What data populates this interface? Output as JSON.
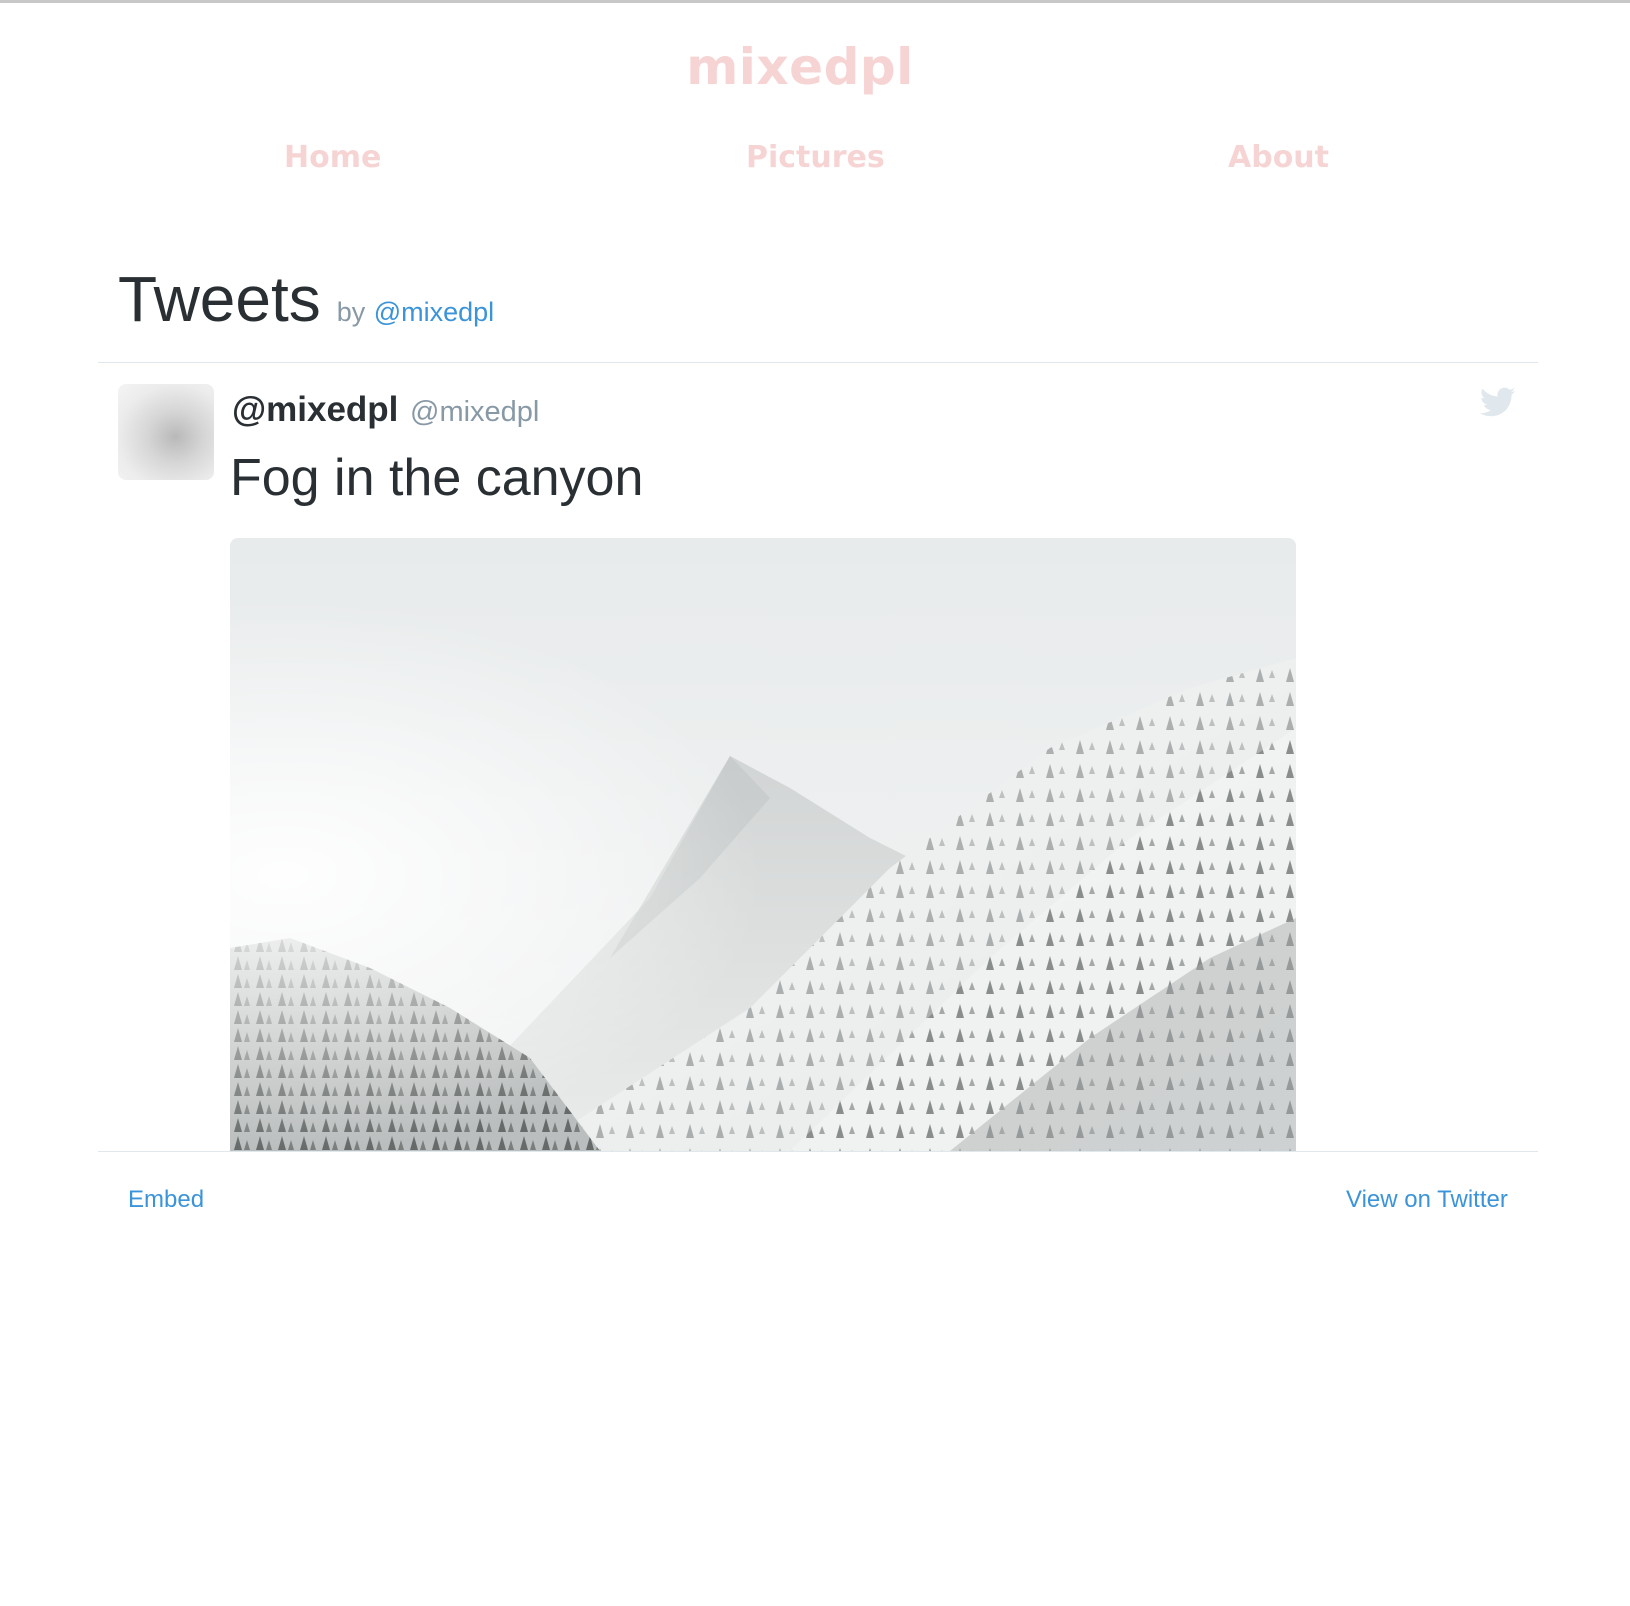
{
  "site": {
    "title": "mixedpl",
    "nav": [
      {
        "label": "Home"
      },
      {
        "label": "Pictures"
      },
      {
        "label": "About"
      }
    ]
  },
  "widget": {
    "title": "Tweets",
    "by_label": "by",
    "handle": "@mixedpl"
  },
  "tweet": {
    "display_name": "@mixedpl",
    "screen_name": "@mixedpl",
    "text": "Fog in the canyon",
    "media_icon": "bird-icon"
  },
  "footer": {
    "embed_label": "Embed",
    "view_label": "View on Twitter"
  },
  "colors": {
    "site_pink": "#f7d4d4",
    "link_blue": "#3b94d9",
    "text_dark": "#292f33",
    "text_muted": "#8899a6",
    "divider": "#e1e8ed"
  }
}
